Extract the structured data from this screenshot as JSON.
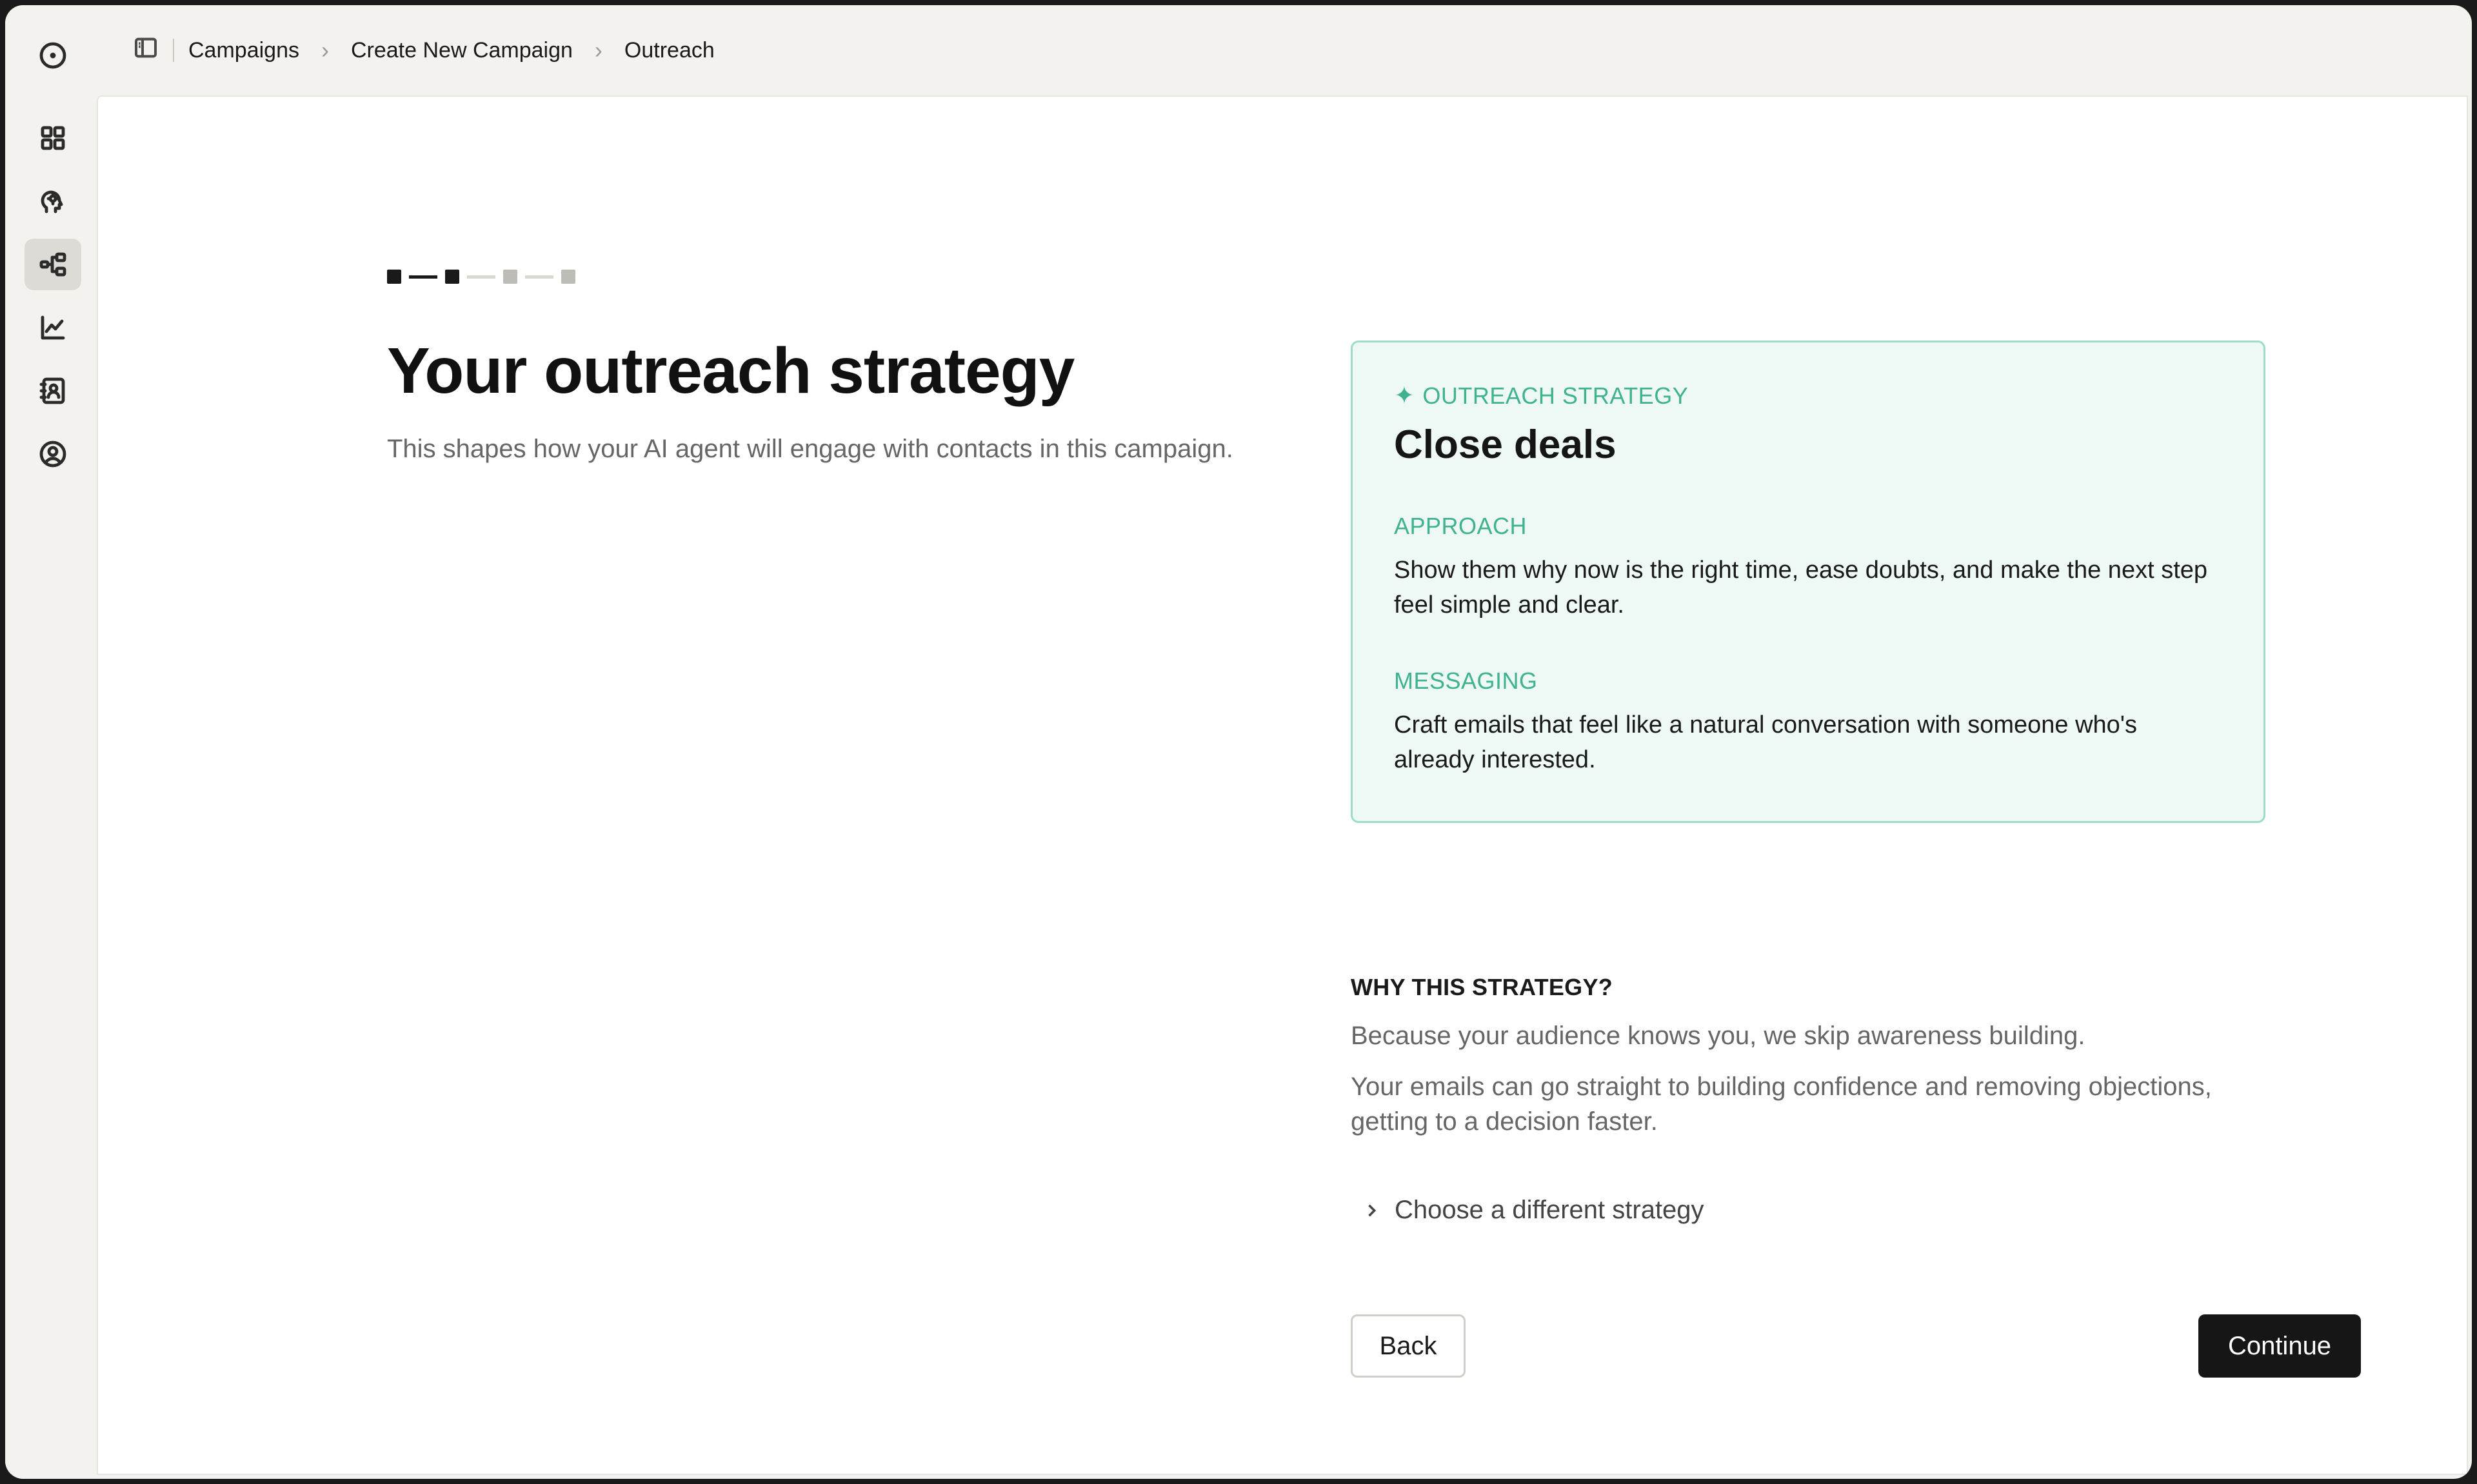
{
  "breadcrumb": {
    "items": [
      "Campaigns",
      "Create New Campaign",
      "Outreach"
    ]
  },
  "sidebar": {
    "items": [
      {
        "name": "circle-dot-icon"
      },
      {
        "name": "grid-icon"
      },
      {
        "name": "brain-icon"
      },
      {
        "name": "workflow-icon",
        "active": true
      },
      {
        "name": "chart-icon"
      },
      {
        "name": "contacts-icon"
      },
      {
        "name": "user-circle-icon"
      }
    ]
  },
  "progress": {
    "current_step": 2,
    "total_steps": 4
  },
  "page": {
    "title": "Your outreach strategy",
    "subtitle": "This shapes how your AI agent will engage with contacts in this campaign."
  },
  "strategy_card": {
    "eyebrow": "OUTREACH STRATEGY",
    "heading": "Close deals",
    "approach_label": "APPROACH",
    "approach_text": "Show them why now is the right time, ease doubts, and make the next step feel simple and clear.",
    "messaging_label": "MESSAGING",
    "messaging_text": "Craft emails that feel like a natural conversation with someone who's already interested."
  },
  "why": {
    "title": "WHY THIS STRATEGY?",
    "line1": "Because your audience knows you, we skip awareness building.",
    "line2": "Your emails can go straight to building confidence and removing objections, getting to a decision faster."
  },
  "choose_label": "Choose a different strategy",
  "buttons": {
    "back": "Back",
    "continue": "Continue"
  },
  "colors": {
    "accent": "#3fb38f",
    "card_bg": "#eef8f5",
    "card_border": "#9fdcc7",
    "primary_button": "#161616"
  }
}
